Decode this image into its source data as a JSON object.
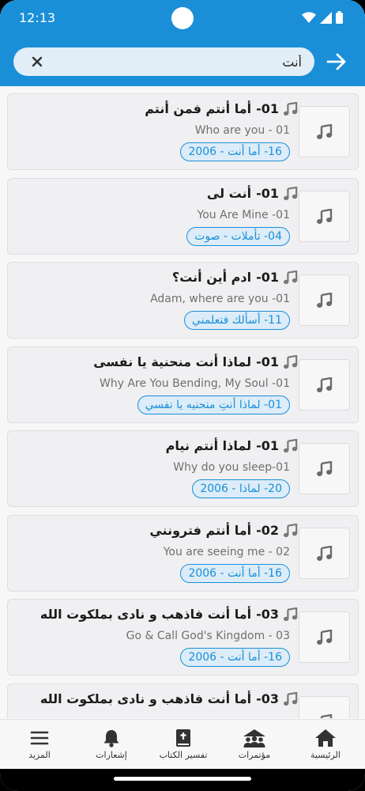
{
  "status_bar": {
    "time": "12:13"
  },
  "search": {
    "value": "أنت"
  },
  "results": [
    {
      "number": "01-",
      "title": "أما أنتم فمن أنتم",
      "subtitle": "Who are you - 01",
      "chip": "16- أما أنت - 2006"
    },
    {
      "number": "01-",
      "title": "أنت لى",
      "subtitle": "You Are Mine -01",
      "chip": "04- تأملات - صوت"
    },
    {
      "number": "01-",
      "title": "ادم أين أنت؟",
      "subtitle": "Adam, where are you -01",
      "chip": "11- أسألك فتعلمني"
    },
    {
      "number": "01-",
      "title": "لماذا أنت منحنية يا نفسى",
      "subtitle": "Why Are You Bending, My Soul -01",
      "chip": "01- لماذا أنتِ منحنيه يا نفسي"
    },
    {
      "number": "01-",
      "title": "لماذا أنتم نيام",
      "subtitle": "Why do you sleep-01",
      "chip": "20- لماذا - 2006"
    },
    {
      "number": "02-",
      "title": "أما أنتم فترونني",
      "subtitle": "You are seeing me - 02",
      "chip": "16- أما أنت - 2006"
    },
    {
      "number": "03-",
      "title": "أما أنت فاذهب و نادى بملكوت الله",
      "subtitle": "Go & Call God's Kingdom - 03",
      "chip": "16- أما أنت - 2006"
    },
    {
      "number": "03-",
      "title": "أما أنت فاذهب و نادى بملكوت الله",
      "subtitle": "",
      "chip": ""
    }
  ],
  "nav": {
    "home": "الرئيسية",
    "conferences": "مؤتمرات",
    "bible_commentary": "تفسير الكتاب",
    "notifications": "إشعارات",
    "more": "المزيد"
  },
  "colors": {
    "accent": "#1a8fd8",
    "card_bg": "#f0f0f2",
    "chip_bg": "#dcecf8"
  }
}
